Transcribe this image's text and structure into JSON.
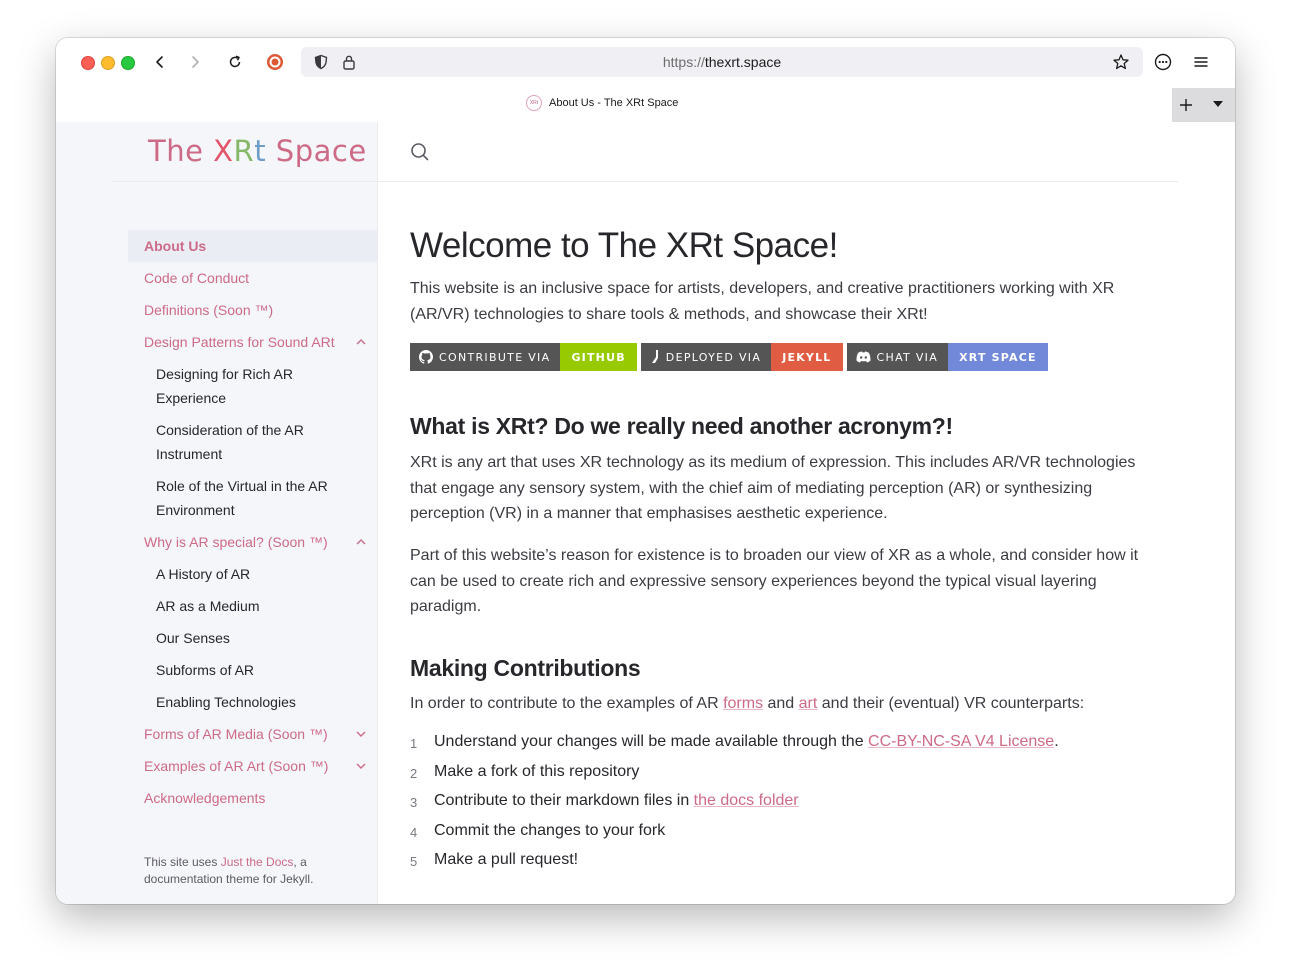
{
  "browser": {
    "url_scheme": "https://",
    "url_host": "thexrt.space",
    "tab_title": "About Us - The XRt Space",
    "favicon_text": "XRt"
  },
  "site": {
    "title_pre": "The ",
    "title_x": "X",
    "title_r": "R",
    "title_t": "t",
    "title_post": " Space"
  },
  "nav": {
    "about": "About Us",
    "conduct": "Code of Conduct",
    "definitions": "Definitions (Soon ™)",
    "design_patterns": "Design Patterns for Sound ARt",
    "dp_sub": [
      "Designing for Rich AR Experience",
      "Consideration of the AR Instrument",
      "Role of the Virtual in the AR Environment"
    ],
    "why_special": "Why is AR special? (Soon ™)",
    "ws_sub": [
      "A History of AR",
      "AR as a Medium",
      "Our Senses",
      "Subforms of AR",
      "Enabling Technologies"
    ],
    "forms": "Forms of AR Media (Soon ™)",
    "examples": "Examples of AR Art (Soon ™)",
    "acknowledgements": "Acknowledgements"
  },
  "footer": {
    "pre": "This site uses ",
    "link": "Just the Docs",
    "post": ", a documentation theme for Jekyll."
  },
  "main": {
    "heading": "Welcome to The XRt Space!",
    "intro": "This website is an inclusive space for artists, developers, and creative practitioners working with XR (AR/VR) technologies to share tools & methods, and showcase their XRt!",
    "badges": [
      {
        "label": "CONTRIBUTE VIA",
        "value": "GITHUB",
        "color": "#97ca00"
      },
      {
        "label": "DEPLOYED VIA",
        "value": "JEKYLL",
        "color": "#e05d44"
      },
      {
        "label": "CHAT VIA",
        "value": "XRT SPACE",
        "color": "#7289da"
      }
    ],
    "h2_what": "What is XRt? Do we really need another acronym?!",
    "p_what": "XRt is any art that uses XR technology as its medium of expression. This includes AR/VR technologies that engage any sensory system, with the chief aim of mediating perception (AR) or synthesizing perception (VR) in a manner that emphasises aesthetic experience.",
    "p_reason": "Part of this website’s reason for existence is to broaden our view of XR as a whole, and consider how it can be used to create rich and expressive sensory experiences beyond the typical visual layering paradigm.",
    "h2_contrib": "Making Contributions",
    "contrib_pre": "In order to contribute to the examples of AR ",
    "contrib_link1": "forms",
    "contrib_mid": " and ",
    "contrib_link2": "art",
    "contrib_post": " and their (eventual) VR counterparts:",
    "steps": [
      {
        "num": "1",
        "pre": "Understand your changes will be made available through the ",
        "link": "CC-BY-NC-SA V4 License",
        "post": "."
      },
      {
        "num": "2",
        "pre": "Make a fork of this repository",
        "link": "",
        "post": ""
      },
      {
        "num": "3",
        "pre": "Contribute to their markdown files in ",
        "link": "the docs folder",
        "post": ""
      },
      {
        "num": "4",
        "pre": "Commit the changes to your fork",
        "link": "",
        "post": ""
      },
      {
        "num": "5",
        "pre": "Make a pull request!",
        "link": "",
        "post": ""
      }
    ]
  }
}
